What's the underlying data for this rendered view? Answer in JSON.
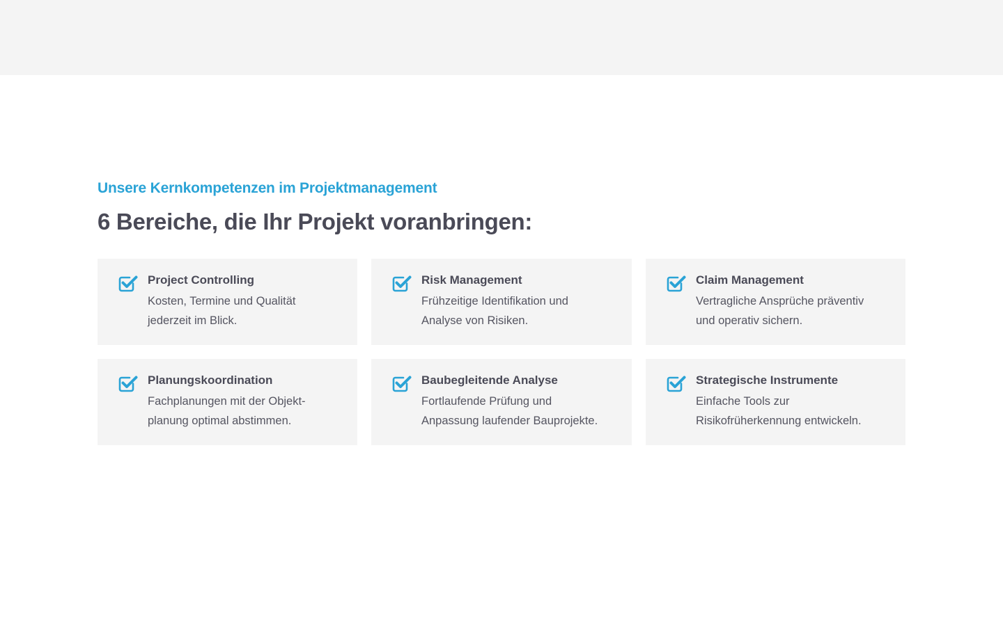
{
  "colors": {
    "accent": "#2aa3d6",
    "text": "#4a4a57",
    "card_bg": "#f4f4f4"
  },
  "section": {
    "eyebrow": "Unsere Kernkompetenzen im Projektmanagement",
    "headline": "6 Bereiche, die Ihr Projekt voranbringen:"
  },
  "cards": [
    {
      "icon": "checkbox-checked-icon",
      "title": "Project Controlling",
      "line1": "Kosten, Termine und Qualität",
      "line2": "jederzeit im Blick."
    },
    {
      "icon": "checkbox-checked-icon",
      "title": "Risk Management",
      "line1": "Frühzeitige Identifikation und",
      "line2": "Analyse von Risiken."
    },
    {
      "icon": "checkbox-checked-icon",
      "title": "Claim Management",
      "line1": "Vertragliche Ansprüche präventiv",
      "line2": "und operativ sichern."
    },
    {
      "icon": "checkbox-checked-icon",
      "title": "Planungskoordination",
      "line1": "Fachplanungen mit der Objekt-",
      "line2": "planung optimal abstimmen."
    },
    {
      "icon": "checkbox-checked-icon",
      "title": "Baubegleitende Analyse",
      "line1": "Fortlaufende Prüfung und",
      "line2": "Anpassung laufender Bauprojekte."
    },
    {
      "icon": "checkbox-checked-icon",
      "title": "Strategische Instrumente",
      "line1": "Einfache Tools zur",
      "line2": "Risikofrüherkennung entwickeln."
    }
  ]
}
